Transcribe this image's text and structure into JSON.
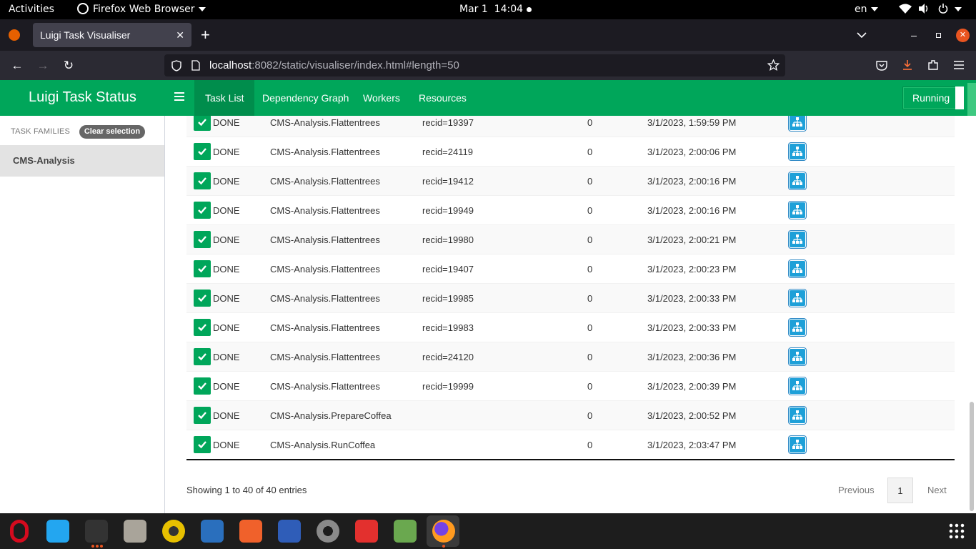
{
  "system_bar": {
    "activities": "Activities",
    "app_menu": "Firefox Web Browser",
    "clock": "Mar 1  14:04",
    "language": "en"
  },
  "browser": {
    "tab_title": "Luigi Task Visualiser",
    "url_host": "localhost",
    "url_rest": ":8082/static/visualiser/index.html#length=50"
  },
  "header": {
    "brand": "Luigi Task Status",
    "tabs": [
      "Task List",
      "Dependency Graph",
      "Workers",
      "Resources"
    ],
    "active_tab": "Task List",
    "running_label": "Running"
  },
  "sidebar": {
    "title": "TASK FAMILIES",
    "clear_button": "Clear selection",
    "families": [
      "CMS-Analysis"
    ]
  },
  "tasks": [
    {
      "status": "DONE",
      "name": "CMS-Analysis.Flattentrees",
      "params": "recid=19397",
      "priority": "0",
      "time": "3/1/2023, 1:59:59 PM"
    },
    {
      "status": "DONE",
      "name": "CMS-Analysis.Flattentrees",
      "params": "recid=24119",
      "priority": "0",
      "time": "3/1/2023, 2:00:06 PM"
    },
    {
      "status": "DONE",
      "name": "CMS-Analysis.Flattentrees",
      "params": "recid=19412",
      "priority": "0",
      "time": "3/1/2023, 2:00:16 PM"
    },
    {
      "status": "DONE",
      "name": "CMS-Analysis.Flattentrees",
      "params": "recid=19949",
      "priority": "0",
      "time": "3/1/2023, 2:00:16 PM"
    },
    {
      "status": "DONE",
      "name": "CMS-Analysis.Flattentrees",
      "params": "recid=19980",
      "priority": "0",
      "time": "3/1/2023, 2:00:21 PM"
    },
    {
      "status": "DONE",
      "name": "CMS-Analysis.Flattentrees",
      "params": "recid=19407",
      "priority": "0",
      "time": "3/1/2023, 2:00:23 PM"
    },
    {
      "status": "DONE",
      "name": "CMS-Analysis.Flattentrees",
      "params": "recid=19985",
      "priority": "0",
      "time": "3/1/2023, 2:00:33 PM"
    },
    {
      "status": "DONE",
      "name": "CMS-Analysis.Flattentrees",
      "params": "recid=19983",
      "priority": "0",
      "time": "3/1/2023, 2:00:33 PM"
    },
    {
      "status": "DONE",
      "name": "CMS-Analysis.Flattentrees",
      "params": "recid=24120",
      "priority": "0",
      "time": "3/1/2023, 2:00:36 PM"
    },
    {
      "status": "DONE",
      "name": "CMS-Analysis.Flattentrees",
      "params": "recid=19999",
      "priority": "0",
      "time": "3/1/2023, 2:00:39 PM"
    },
    {
      "status": "DONE",
      "name": "CMS-Analysis.PrepareCoffea",
      "params": "",
      "priority": "0",
      "time": "3/1/2023, 2:00:52 PM"
    },
    {
      "status": "DONE",
      "name": "CMS-Analysis.RunCoffea",
      "params": "",
      "priority": "0",
      "time": "3/1/2023, 2:03:47 PM"
    }
  ],
  "footer": {
    "info": "Showing 1 to 40 of 40 entries",
    "previous": "Previous",
    "page": "1",
    "next": "Next"
  },
  "colors": {
    "header_green": "#00a65a",
    "done_green": "#00a65a",
    "graph_button_blue": "#1ea0d8"
  },
  "dock_icons": [
    "opera-icon",
    "vscode-icon",
    "terminal-icon",
    "files-icon",
    "rhythmbox-icon",
    "writer-icon",
    "software-icon",
    "text-editor-icon",
    "settings-icon",
    "git-icon",
    "game-icon",
    "firefox-icon",
    "apps-grid-icon"
  ]
}
